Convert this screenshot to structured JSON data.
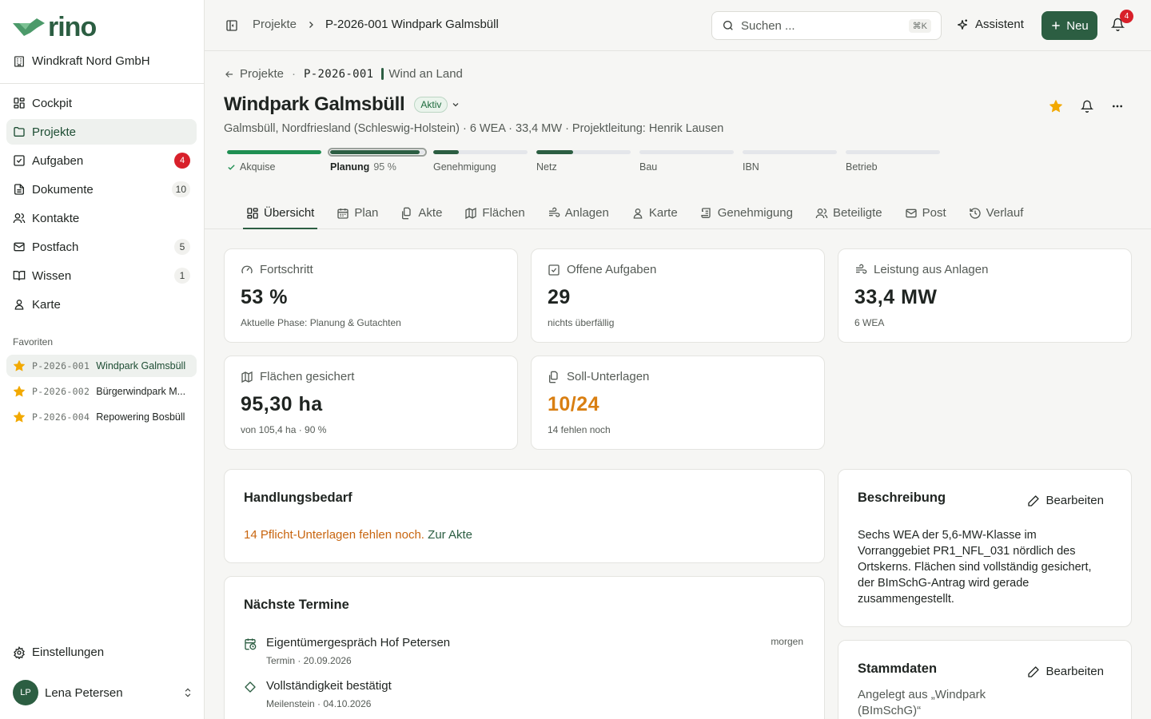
{
  "brand": {
    "name": "rino",
    "org": "Windkraft Nord GmbH"
  },
  "nav": [
    {
      "label": "Cockpit",
      "icon": "grid-icon"
    },
    {
      "label": "Projekte",
      "icon": "folder-icon",
      "active": true
    },
    {
      "label": "Aufgaben",
      "icon": "check-square-icon",
      "badge": "4",
      "badge_style": "red"
    },
    {
      "label": "Dokumente",
      "icon": "document-icon",
      "badge": "10"
    },
    {
      "label": "Kontakte",
      "icon": "users-icon"
    },
    {
      "label": "Postfach",
      "icon": "mail-icon",
      "badge": "5"
    },
    {
      "label": "Wissen",
      "icon": "book-icon",
      "badge": "1"
    },
    {
      "label": "Karte",
      "icon": "map-pin-icon"
    }
  ],
  "favorites": {
    "title": "Favoriten",
    "items": [
      {
        "code": "P-2026-001",
        "name": "Windpark Galmsbüll",
        "active": true
      },
      {
        "code": "P-2026-002",
        "name": "Bürgerwindpark M..."
      },
      {
        "code": "P-2026-004",
        "name": "Repowering Bosbüll"
      }
    ]
  },
  "settings_label": "Einstellungen",
  "user": {
    "initials": "LP",
    "name": "Lena Petersen"
  },
  "topbar": {
    "crumb_root": "Projekte",
    "crumb_current": "P-2026-001 Windpark Galmsbüll",
    "search_placeholder": "Suchen ...",
    "search_shortcut": "⌘K",
    "assistant_label": "Assistent",
    "new_label": "Neu",
    "notifications": "4"
  },
  "project": {
    "back_label": "Projekte",
    "code": "P-2026-001",
    "type": "Wind an Land",
    "title": "Windpark Galmsbüll",
    "status": "Aktiv",
    "subtitle": "Galmsbüll, Nordfriesland (Schleswig-Holstein) · 6 WEA · 33,4 MW · Projektleitung: Henrik Lausen"
  },
  "phases": [
    {
      "label": "Akquise",
      "progress": 1.0,
      "state": "done"
    },
    {
      "label": "Planung",
      "pct": "95 %",
      "progress": 0.95,
      "state": "current"
    },
    {
      "label": "Genehmigung",
      "progress": 0.27,
      "state": "open"
    },
    {
      "label": "Netz",
      "progress": 0.39,
      "state": "open"
    },
    {
      "label": "Bau",
      "progress": 0,
      "state": "open"
    },
    {
      "label": "IBN",
      "progress": 0,
      "state": "open"
    },
    {
      "label": "Betrieb",
      "progress": 0,
      "state": "open"
    }
  ],
  "tabs": [
    {
      "label": "Übersicht",
      "icon": "grid-icon",
      "active": true
    },
    {
      "label": "Plan",
      "icon": "calendar-icon"
    },
    {
      "label": "Akte",
      "icon": "files-icon"
    },
    {
      "label": "Flächen",
      "icon": "map-icon"
    },
    {
      "label": "Anlagen",
      "icon": "wind-icon"
    },
    {
      "label": "Karte",
      "icon": "map-pin-icon"
    },
    {
      "label": "Genehmigung",
      "icon": "scroll-icon"
    },
    {
      "label": "Beteiligte",
      "icon": "users-icon"
    },
    {
      "label": "Post",
      "icon": "mail-icon"
    },
    {
      "label": "Verlauf",
      "icon": "history-icon"
    }
  ],
  "kpis": {
    "progress": {
      "label": "Fortschritt",
      "value": "53 %",
      "sub": "Aktuelle Phase: Planung & Gutachten"
    },
    "tasks": {
      "label": "Offene Aufgaben",
      "value": "29",
      "sub": "nichts überfällig"
    },
    "power": {
      "label": "Leistung aus Anlagen",
      "value": "33,4 MW",
      "sub": "6 WEA"
    },
    "areas": {
      "label": "Flächen gesichert",
      "value": "95,30 ha",
      "sub": "von 105,4 ha · 90 %"
    },
    "docs": {
      "label": "Soll-Unterlagen",
      "value": "10/24",
      "sub": "14 fehlen noch"
    }
  },
  "action": {
    "title": "Handlungsbedarf",
    "text": "14 Pflicht-Unterlagen fehlen noch.",
    "link": "Zur Akte"
  },
  "description": {
    "title": "Beschreibung",
    "edit_label": "Bearbeiten",
    "text": "Sechs WEA der 5,6-MW-Klasse im Vorranggebiet PR1_NFL_031 nördlich des Ortskerns. Flächen sind vollständig gesichert, der BImSchG-Antrag wird gerade zusammengestellt."
  },
  "events": {
    "title": "Nächste Termine",
    "items": [
      {
        "name": "Eigentümergespräch Hof Petersen",
        "sub": "Termin · 20.09.2026",
        "when": "morgen",
        "icon": "calendar-clock-icon"
      },
      {
        "name": "Vollständigkeit bestätigt",
        "sub": "Meilenstein · 04.10.2026",
        "when": "",
        "icon": "diamond-icon"
      }
    ]
  },
  "master": {
    "title": "Stammdaten",
    "edit_label": "Bearbeiten",
    "sub": "Angelegt aus „Windpark (BImSchG)“"
  },
  "colors": {
    "accent": "#2c5e42",
    "danger": "#d8202a",
    "warning": "#d97f12",
    "star": "#f2a900"
  }
}
